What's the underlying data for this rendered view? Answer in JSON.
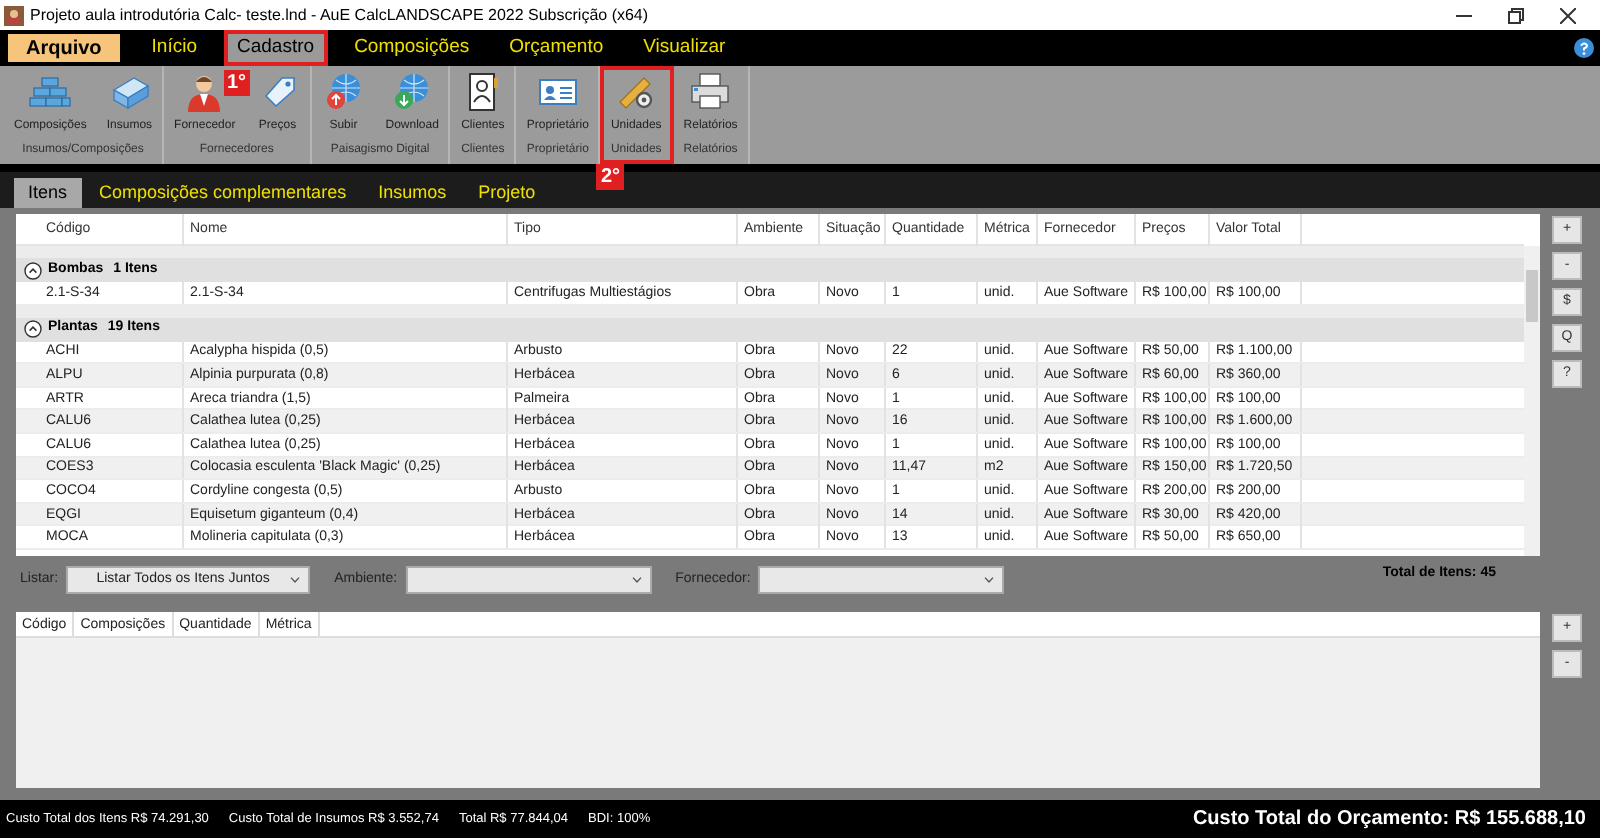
{
  "window": {
    "title": "Projeto aula introdutória Calc- teste.lnd - AuE CalcLANDSCAPE 2022 Subscrição (x64)"
  },
  "menu": [
    {
      "label": "Arquivo",
      "kind": "file",
      "selected": false,
      "highlighted": false
    },
    {
      "label": "Início",
      "kind": "tab",
      "selected": false,
      "highlighted": false
    },
    {
      "label": "Cadastro",
      "kind": "tab",
      "selected": true,
      "highlighted": true,
      "annotation": "1°"
    },
    {
      "label": "Composições",
      "kind": "tab",
      "selected": false,
      "highlighted": false
    },
    {
      "label": "Orçamento",
      "kind": "tab",
      "selected": false,
      "highlighted": false
    },
    {
      "label": "Visualizar",
      "kind": "tab",
      "selected": false,
      "highlighted": false
    }
  ],
  "ribbon": {
    "groups": [
      {
        "label": "Insumos/Composições",
        "highlighted": false,
        "buttons": [
          {
            "label": "Composições"
          },
          {
            "label": "Insumos"
          }
        ]
      },
      {
        "label": "Fornecedores",
        "highlighted": false,
        "buttons": [
          {
            "label": "Fornecedor"
          },
          {
            "label": "Preços"
          }
        ]
      },
      {
        "label": "Paisagismo Digital",
        "highlighted": false,
        "buttons": [
          {
            "label": "Subir"
          },
          {
            "label": "Download"
          }
        ]
      },
      {
        "label": "Clientes",
        "highlighted": false,
        "buttons": [
          {
            "label": "Clientes"
          }
        ]
      },
      {
        "label": "Proprietário",
        "highlighted": false,
        "buttons": [
          {
            "label": "Proprietário"
          }
        ]
      },
      {
        "label": "Unidades",
        "highlighted": true,
        "annotation": "2°",
        "buttons": [
          {
            "label": "Unidades"
          }
        ]
      },
      {
        "label": "Relatórios",
        "highlighted": false,
        "buttons": [
          {
            "label": "Relatórios"
          }
        ]
      }
    ]
  },
  "doc_tabs": [
    {
      "label": "Itens",
      "selected": true
    },
    {
      "label": "Composições complementares",
      "selected": false
    },
    {
      "label": "Insumos",
      "selected": false
    },
    {
      "label": "Projeto",
      "selected": false
    }
  ],
  "table": {
    "columns": [
      "Código",
      "Nome",
      "Tipo",
      "Ambiente",
      "Situação",
      "Quantidade",
      "Métrica",
      "Fornecedor",
      "Preços",
      "Valor Total"
    ],
    "groups": [
      {
        "name": "Bombas",
        "count": "1 Itens",
        "expanded": true,
        "rows": [
          [
            "2.1-S-34",
            "2.1-S-34",
            "Centrifugas Multiestágios",
            "Obra",
            "Novo",
            "1",
            "unid.",
            "Aue Software",
            "R$ 100,00",
            "R$ 100,00"
          ]
        ]
      },
      {
        "name": "Plantas",
        "count": "19 Itens",
        "expanded": true,
        "rows": [
          [
            "ACHI",
            "Acalypha hispida (0,5)",
            "Arbusto",
            "Obra",
            "Novo",
            "22",
            "unid.",
            "Aue Software",
            "R$ 50,00",
            "R$ 1.100,00"
          ],
          [
            "ALPU",
            "Alpinia purpurata (0,8)",
            "Herbácea",
            "Obra",
            "Novo",
            "6",
            "unid.",
            "Aue Software",
            "R$ 60,00",
            "R$ 360,00"
          ],
          [
            "ARTR",
            "Areca triandra (1,5)",
            "Palmeira",
            "Obra",
            "Novo",
            "1",
            "unid.",
            "Aue Software",
            "R$ 100,00",
            "R$ 100,00"
          ],
          [
            "CALU6",
            "Calathea lutea (0,25)",
            "Herbácea",
            "Obra",
            "Novo",
            "16",
            "unid.",
            "Aue Software",
            "R$ 100,00",
            "R$ 1.600,00"
          ],
          [
            "CALU6",
            "Calathea lutea (0,25)",
            "Herbácea",
            "Obra",
            "Novo",
            "1",
            "unid.",
            "Aue Software",
            "R$ 100,00",
            "R$ 100,00"
          ],
          [
            "COES3",
            "Colocasia esculenta 'Black Magic' (0,25)",
            "Herbácea",
            "Obra",
            "Novo",
            "11,47",
            "m2",
            "Aue Software",
            "R$ 150,00",
            "R$ 1.720,50"
          ],
          [
            "COCO4",
            "Cordyline congesta (0,5)",
            "Arbusto",
            "Obra",
            "Novo",
            "1",
            "unid.",
            "Aue Software",
            "R$ 200,00",
            "R$ 200,00"
          ],
          [
            "EQGI",
            "Equisetum giganteum (0,4)",
            "Herbácea",
            "Obra",
            "Novo",
            "14",
            "unid.",
            "Aue Software",
            "R$ 30,00",
            "R$ 420,00"
          ],
          [
            "MOCA",
            "Molineria capitulata (0,3)",
            "Herbácea",
            "Obra",
            "Novo",
            "13",
            "unid.",
            "Aue Software",
            "R$ 50,00",
            "R$ 650,00"
          ]
        ]
      }
    ]
  },
  "side_buttons": [
    "+",
    "-",
    "$",
    "Q",
    "?"
  ],
  "filters": [
    {
      "label": "Listar:",
      "value": "Listar Todos os Itens Juntos"
    },
    {
      "label": "Ambiente:"
    },
    {
      "label": "Fornecedor:"
    }
  ],
  "total_items": "Total de Itens: 45",
  "lower_table": {
    "columns": [
      "Código",
      "Composições",
      "Quantidade",
      "Métrica"
    ]
  },
  "lower_side_buttons": [
    "+",
    "-"
  ],
  "status": {
    "items": [
      "Custo Total dos Itens R$ 74.291,30",
      "Custo Total de Insumos R$ 3.552,74",
      "Total R$ 77.844,04",
      "BDI: 100%"
    ],
    "total": "Custo Total do Orçamento: R$ 155.688,10"
  }
}
